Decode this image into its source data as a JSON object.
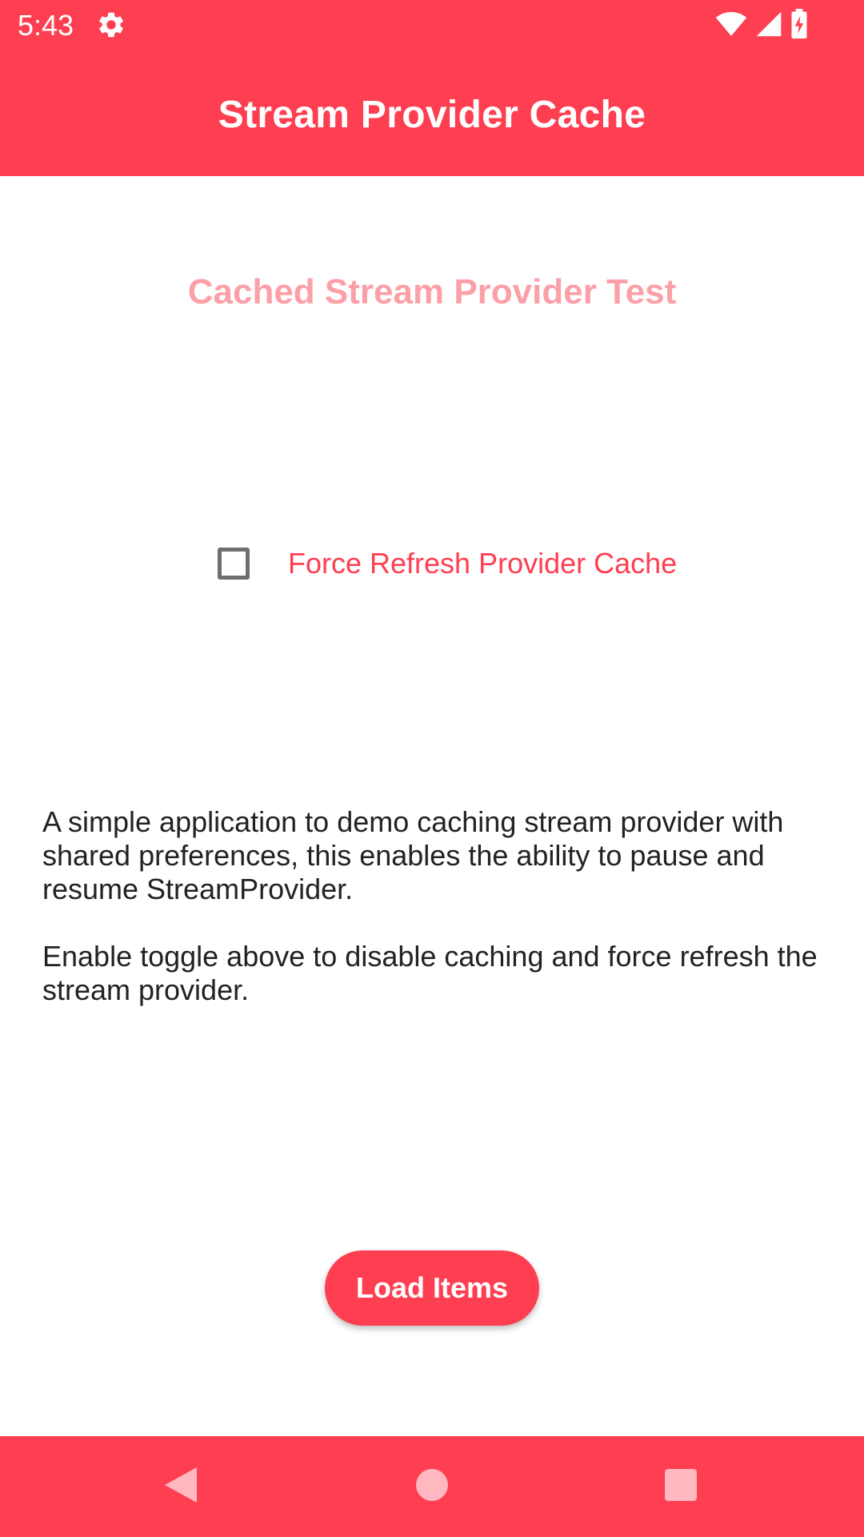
{
  "status_bar": {
    "time": "5:43",
    "icons": [
      "settings-icon",
      "wifi-icon",
      "cellular-signal-icon",
      "battery-charging-icon"
    ]
  },
  "app_bar": {
    "title": "Stream Provider Cache"
  },
  "main": {
    "heading": "Cached Stream Provider Test",
    "checkbox": {
      "label": "Force Refresh Provider Cache",
      "checked": false
    },
    "description": {
      "paragraph_1": "A simple application to demo caching stream provider with shared preferences, this enables the ability to pause and resume StreamProvider.",
      "paragraph_2": "Enable toggle above to disable caching and force refresh the stream provider."
    },
    "load_button": {
      "label": "Load Items"
    }
  },
  "nav_bar": {
    "icons": [
      "back-icon",
      "home-icon",
      "recents-icon"
    ]
  },
  "colors": {
    "primary": "#fe3e51",
    "heading": "#fca0a8",
    "text": "#222222",
    "checkbox_border": "#6e6e6e",
    "nav_icons": "#ffb8bf"
  }
}
